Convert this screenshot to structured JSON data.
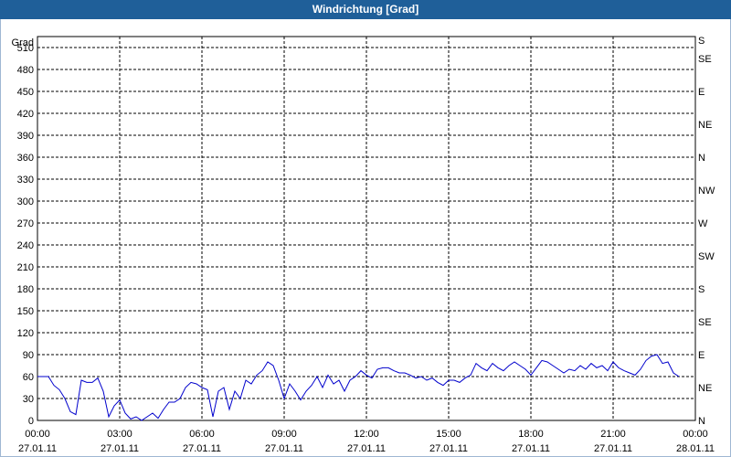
{
  "window": {
    "title": "Windrichtung [Grad]"
  },
  "chart_data": {
    "type": "line",
    "title": "Windrichtung [Grad]",
    "ylabel": "Grad",
    "ylim": [
      0,
      525
    ],
    "yticks": [
      0,
      30,
      60,
      90,
      120,
      150,
      180,
      210,
      240,
      270,
      300,
      330,
      360,
      390,
      420,
      450,
      480,
      510
    ],
    "right_axis_labels": [
      {
        "value": 0,
        "label": "N"
      },
      {
        "value": 45,
        "label": "NE"
      },
      {
        "value": 90,
        "label": "E"
      },
      {
        "value": 135,
        "label": "SE"
      },
      {
        "value": 180,
        "label": "S"
      },
      {
        "value": 225,
        "label": "SW"
      },
      {
        "value": 270,
        "label": "W"
      },
      {
        "value": 315,
        "label": "NW"
      },
      {
        "value": 360,
        "label": "N"
      },
      {
        "value": 405,
        "label": "NE"
      },
      {
        "value": 450,
        "label": "E"
      },
      {
        "value": 495,
        "label": "SE"
      },
      {
        "value": 540,
        "label": "S"
      }
    ],
    "xlim": [
      0,
      24
    ],
    "xticks": [
      {
        "h": 0,
        "time": "00:00",
        "date": "27.01.11"
      },
      {
        "h": 3,
        "time": "03:00",
        "date": "27.01.11"
      },
      {
        "h": 6,
        "time": "06:00",
        "date": "27.01.11"
      },
      {
        "h": 9,
        "time": "09:00",
        "date": "27.01.11"
      },
      {
        "h": 12,
        "time": "12:00",
        "date": "27.01.11"
      },
      {
        "h": 15,
        "time": "15:00",
        "date": "27.01.11"
      },
      {
        "h": 18,
        "time": "18:00",
        "date": "27.01.11"
      },
      {
        "h": 21,
        "time": "21:00",
        "date": "27.01.11"
      },
      {
        "h": 24,
        "time": "00:00",
        "date": "28.01.11"
      }
    ],
    "grid": true,
    "line_color": "#0000cc",
    "x": [
      0,
      0.2,
      0.4,
      0.6,
      0.8,
      1.0,
      1.2,
      1.4,
      1.6,
      1.8,
      2.0,
      2.2,
      2.4,
      2.6,
      2.8,
      3.0,
      3.2,
      3.4,
      3.6,
      3.8,
      4.0,
      4.2,
      4.4,
      4.6,
      4.8,
      5.0,
      5.2,
      5.4,
      5.6,
      5.8,
      6.0,
      6.2,
      6.4,
      6.6,
      6.8,
      7.0,
      7.2,
      7.4,
      7.6,
      7.8,
      8.0,
      8.2,
      8.4,
      8.6,
      8.8,
      9.0,
      9.2,
      9.4,
      9.6,
      9.8,
      10.0,
      10.2,
      10.4,
      10.6,
      10.8,
      11.0,
      11.2,
      11.4,
      11.6,
      11.8,
      12.0,
      12.2,
      12.4,
      12.6,
      12.8,
      13.0,
      13.2,
      13.4,
      13.6,
      13.8,
      14.0,
      14.2,
      14.4,
      14.6,
      14.8,
      15.0,
      15.2,
      15.4,
      15.6,
      15.8,
      16.0,
      16.2,
      16.4,
      16.6,
      16.8,
      17.0,
      17.2,
      17.4,
      17.6,
      17.8,
      18.0,
      18.2,
      18.4,
      18.6,
      18.8,
      19.0,
      19.2,
      19.4,
      19.6,
      19.8,
      20.0,
      20.2,
      20.4,
      20.6,
      20.8,
      21.0,
      21.2,
      21.4,
      21.6,
      21.8,
      22.0,
      22.2,
      22.4,
      22.6,
      22.8,
      23.0,
      23.2,
      23.4,
      23.6,
      23.8
    ],
    "y": [
      60,
      60,
      60,
      48,
      42,
      30,
      12,
      8,
      55,
      52,
      52,
      58,
      40,
      5,
      20,
      28,
      10,
      2,
      5,
      0,
      5,
      10,
      3,
      15,
      25,
      25,
      30,
      45,
      52,
      50,
      45,
      42,
      5,
      40,
      45,
      15,
      40,
      30,
      55,
      50,
      62,
      68,
      80,
      75,
      55,
      30,
      50,
      40,
      28,
      40,
      48,
      60,
      45,
      62,
      50,
      55,
      40,
      55,
      60,
      68,
      62,
      58,
      70,
      72,
      72,
      68,
      65,
      65,
      62,
      58,
      60,
      55,
      58,
      52,
      48,
      55,
      55,
      52,
      58,
      62,
      78,
      72,
      68,
      78,
      72,
      68,
      75,
      80,
      75,
      70,
      62,
      72,
      82,
      80,
      75,
      70,
      65,
      70,
      68,
      75,
      70,
      78,
      72,
      75,
      68,
      80,
      72,
      68,
      65,
      62,
      70,
      82,
      88,
      90,
      78,
      80,
      65,
      60
    ]
  }
}
